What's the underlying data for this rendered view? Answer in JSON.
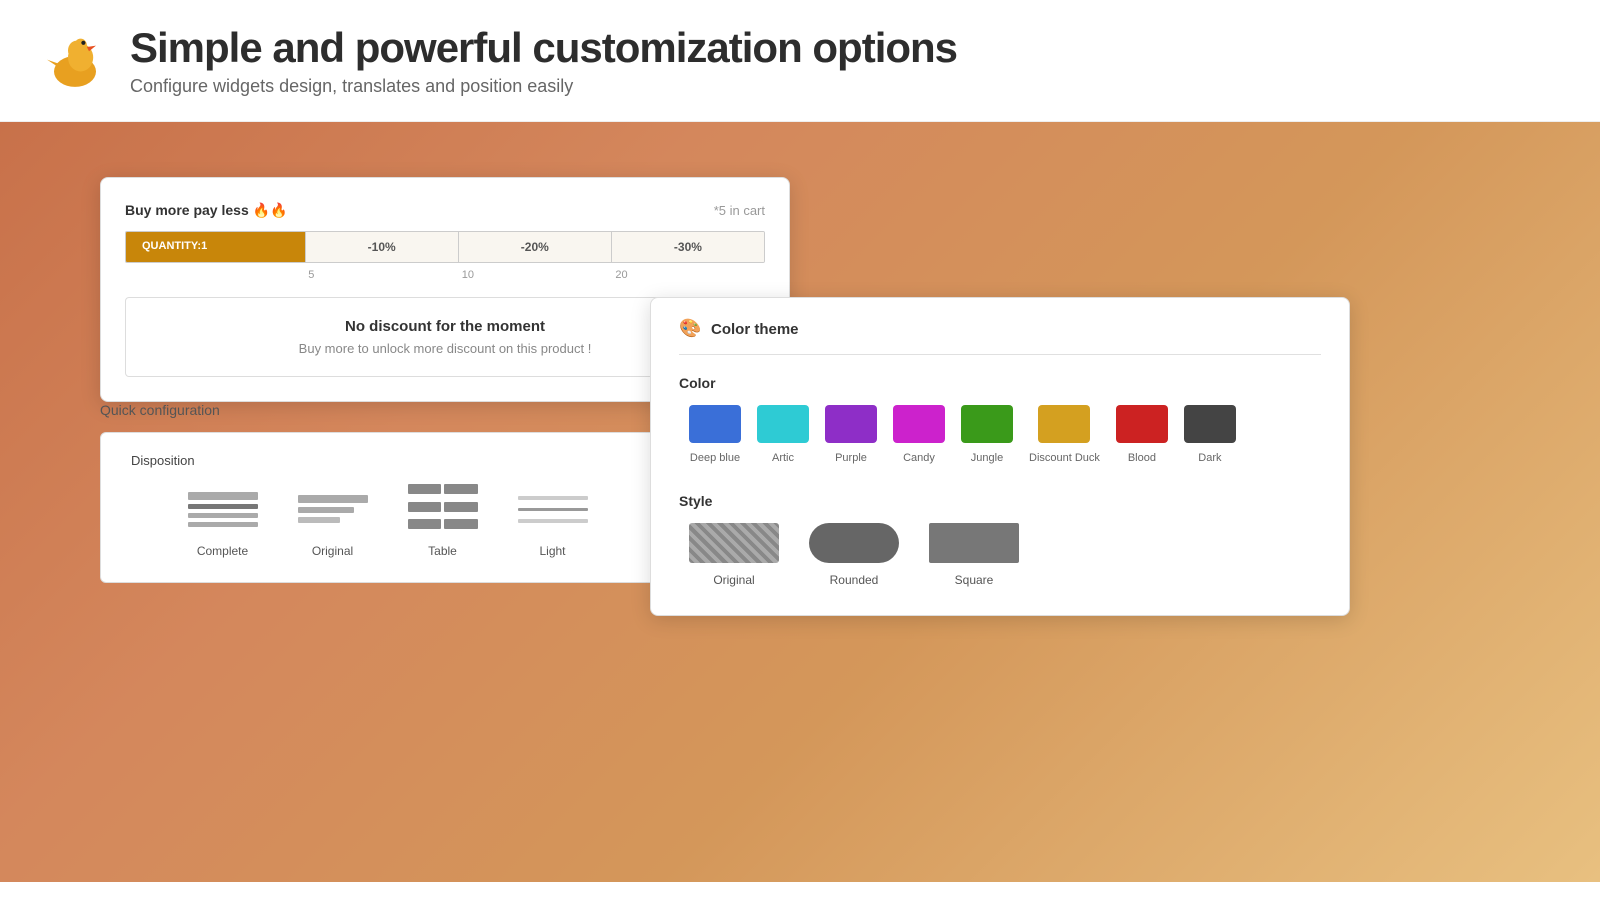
{
  "header": {
    "title": "Simple and powerful customization options",
    "subtitle": "Configure widgets design, translates and position easily"
  },
  "discount_widget": {
    "title": "Buy more pay less 🔥🔥",
    "cart_info": "*5 in cart",
    "quantity_label": "QUANTITY:1",
    "segments": [
      "-10%",
      "-20%",
      "-30%"
    ],
    "labels": [
      "5",
      "10",
      "20"
    ],
    "no_discount_title": "No discount for the moment",
    "no_discount_text": "Buy more to unlock more discount on this product !"
  },
  "quick_config": {
    "title": "Quick configuration",
    "disposition_title": "Disposition",
    "options": [
      {
        "label": "Complete"
      },
      {
        "label": "Original"
      },
      {
        "label": "Table"
      },
      {
        "label": "Light"
      }
    ]
  },
  "color_theme": {
    "panel_title": "Color theme",
    "color_section_label": "Color",
    "colors": [
      {
        "name": "Deep blue",
        "hex": "#3a6fd8"
      },
      {
        "name": "Artic",
        "hex": "#2ecbd4"
      },
      {
        "name": "Purple",
        "hex": "#8e2ec7"
      },
      {
        "name": "Candy",
        "hex": "#cc22cc"
      },
      {
        "name": "Jungle",
        "hex": "#3a9a1a"
      },
      {
        "name": "Discount Duck",
        "hex": "#d4a020"
      },
      {
        "name": "Blood",
        "hex": "#cc2222"
      },
      {
        "name": "Dark",
        "hex": "#444444"
      }
    ],
    "style_section_label": "Style",
    "styles": [
      {
        "label": "Original"
      },
      {
        "label": "Rounded"
      },
      {
        "label": "Square"
      }
    ]
  }
}
